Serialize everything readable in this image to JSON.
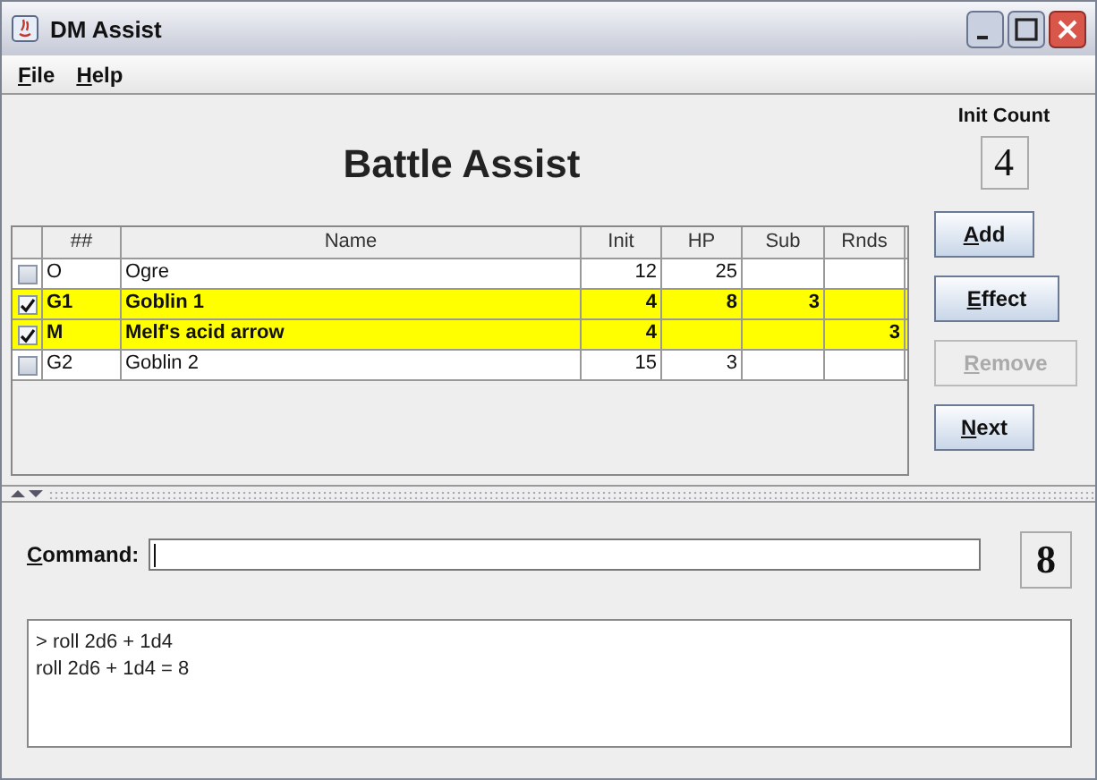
{
  "window": {
    "title": "DM Assist"
  },
  "menu": [
    {
      "label": "File"
    },
    {
      "label": "Help"
    }
  ],
  "heading": "Battle Assist",
  "init_count": {
    "label": "Init Count",
    "value": "4"
  },
  "table": {
    "columns": [
      "##",
      "Name",
      "Init",
      "HP",
      "Sub",
      "Rnds"
    ],
    "rows": [
      {
        "checked": false,
        "cells": [
          "O",
          "Ogre",
          "12",
          "25",
          "",
          ""
        ]
      },
      {
        "checked": true,
        "cells": [
          "G1",
          "Goblin 1",
          "4",
          "8",
          "3",
          ""
        ]
      },
      {
        "checked": true,
        "cells": [
          "M",
          "Melf's acid arrow",
          "4",
          "",
          "",
          "3"
        ]
      },
      {
        "checked": false,
        "cells": [
          "G2",
          "Goblin 2",
          "15",
          "3",
          "",
          ""
        ]
      }
    ]
  },
  "buttons": [
    {
      "label": "Add",
      "disabled": false
    },
    {
      "label": "Effect",
      "disabled": false
    },
    {
      "label": "Remove",
      "disabled": true
    },
    {
      "label": "Next",
      "disabled": false
    }
  ],
  "command": {
    "label": "Command:",
    "result": "8"
  },
  "log": [
    "> roll 2d6 + 1d4",
    "roll 2d6 + 1d4 = 8"
  ]
}
